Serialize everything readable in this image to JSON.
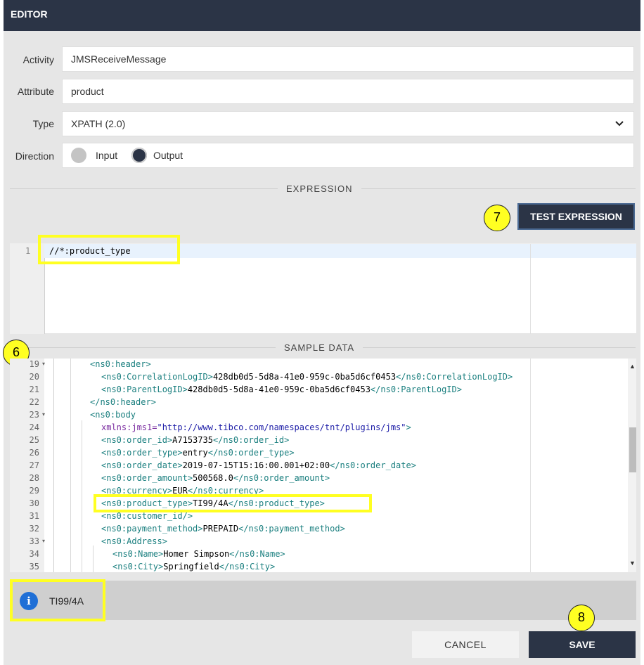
{
  "header": {
    "title": "EDITOR"
  },
  "form": {
    "activity_label": "Activity",
    "activity_value": "JMSReceiveMessage",
    "attribute_label": "Attribute",
    "attribute_value": "product",
    "type_label": "Type",
    "type_value": "XPATH (2.0)",
    "direction_label": "Direction",
    "direction_options": [
      "Input",
      "Output"
    ],
    "direction_selected": "Output"
  },
  "expression": {
    "section_label": "EXPRESSION",
    "test_button_label": "TEST EXPRESSION",
    "line_number": "1",
    "code": "//*:product_type"
  },
  "sample": {
    "section_label": "SAMPLE DATA",
    "lines": [
      {
        "n": "19",
        "fold": true
      },
      {
        "n": "20"
      },
      {
        "n": "21"
      },
      {
        "n": "22"
      },
      {
        "n": "23",
        "fold": true
      },
      {
        "n": "24"
      },
      {
        "n": "25"
      },
      {
        "n": "26"
      },
      {
        "n": "27"
      },
      {
        "n": "28"
      },
      {
        "n": "29"
      },
      {
        "n": "30"
      },
      {
        "n": "31"
      },
      {
        "n": "32"
      },
      {
        "n": "33",
        "fold": true
      },
      {
        "n": "34"
      },
      {
        "n": "35"
      }
    ],
    "text": {
      "l19_open": "<ns0:header>",
      "l20_open": "<ns0:CorrelationLogID>",
      "l20_val": "428db0d5-5d8a-41e0-959c-0ba5d6cf0453",
      "l20_close": "</ns0:CorrelationLogID>",
      "l21_open": "<ns0:ParentLogID>",
      "l21_val": "428db0d5-5d8a-41e0-959c-0ba5d6cf0453",
      "l21_close": "</ns0:ParentLogID>",
      "l22_close": "</ns0:header>",
      "l23_open": "<ns0:body",
      "l24_attr": "xmlns:jms1=",
      "l24_val": "\"http://www.tibco.com/namespaces/tnt/plugins/jms\"",
      "l24_end": ">",
      "l25_open": "<ns0:order_id>",
      "l25_val": "A7153735",
      "l25_close": "</ns0:order_id>",
      "l26_open": "<ns0:order_type>",
      "l26_val": "entry",
      "l26_close": "</ns0:order_type>",
      "l27_open": "<ns0:order_date>",
      "l27_val": "2019-07-15T15:16:00.001+02:00",
      "l27_close": "</ns0:order_date>",
      "l28_open": "<ns0:order_amount>",
      "l28_val": "500568.0",
      "l28_close": "</ns0:order_amount>",
      "l29_open": "<ns0:currency>",
      "l29_val": "EUR",
      "l29_close": "</ns0:currency>",
      "l30_open": "<ns0:product_type>",
      "l30_val": "TI99/4A",
      "l30_close": "</ns0:product_type>",
      "l31_open": "<ns0:customer_id/>",
      "l32_open": "<ns0:payment_method>",
      "l32_val": "PREPAID",
      "l32_close": "</ns0:payment_method>",
      "l33_open": "<ns0:Address>",
      "l34_open": "<ns0:Name>",
      "l34_val": "Homer Simpson",
      "l34_close": "</ns0:Name>",
      "l35_open": "<ns0:City>",
      "l35_val": "Springfield",
      "l35_close": "</ns0:City>"
    }
  },
  "result": {
    "icon": "info-icon",
    "value": "TI99/4A"
  },
  "footer": {
    "cancel_label": "CANCEL",
    "save_label": "SAVE"
  },
  "callouts": {
    "test": "7",
    "sample": "6",
    "save": "8"
  },
  "colors": {
    "primary": "#2b3446",
    "highlight": "#ffff22",
    "info": "#1f6fd6"
  }
}
